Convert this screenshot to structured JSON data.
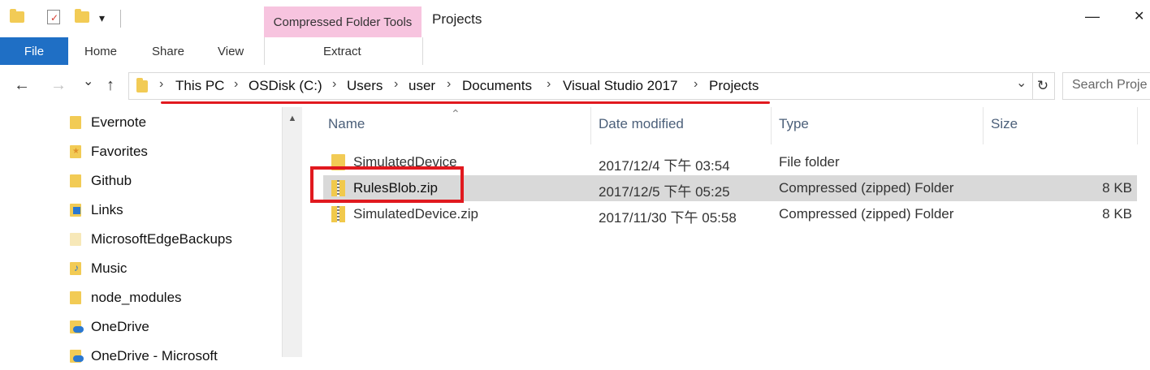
{
  "quick_access": {
    "dropdown_glyph": "▾"
  },
  "title_bar": {
    "contextual_tab": "Compressed Folder Tools",
    "window_title": "Projects",
    "minimize_glyph": "—",
    "close_glyph": "✕"
  },
  "ribbon": {
    "tabs": [
      "File",
      "Home",
      "Share",
      "View",
      "Extract"
    ],
    "file_color": "#1f6fc5",
    "contextual_color": "#f7c4df"
  },
  "address_bar": {
    "crumbs": [
      "This PC",
      "OSDisk (C:)",
      "Users",
      "user",
      "Documents",
      "Visual Studio 2017",
      "Projects"
    ],
    "separator": "›",
    "back_glyph": "←",
    "forward_glyph": "→",
    "recent_glyph": "⌄",
    "up_glyph": "↑",
    "dropdown_glyph": "⌄",
    "refresh_glyph": "↻",
    "search_placeholder": "Search Proje"
  },
  "nav_pane": {
    "items": [
      {
        "label": "Evernote",
        "icon": "folder-icon"
      },
      {
        "label": "Favorites",
        "icon": "favorites-folder-icon"
      },
      {
        "label": "Github",
        "icon": "folder-icon"
      },
      {
        "label": "Links",
        "icon": "links-folder-icon"
      },
      {
        "label": "MicrosoftEdgeBackups",
        "icon": "folder-icon"
      },
      {
        "label": "Music",
        "icon": "music-folder-icon"
      },
      {
        "label": "node_modules",
        "icon": "folder-icon"
      },
      {
        "label": "OneDrive",
        "icon": "onedrive-icon"
      },
      {
        "label": "OneDrive - Microsoft",
        "icon": "onedrive-icon"
      }
    ],
    "scroll_up_glyph": "▲"
  },
  "file_list": {
    "sort_glyph": "⌃",
    "columns": [
      "Name",
      "Date modified",
      "Type",
      "Size"
    ],
    "rows": [
      {
        "name": "SimulatedDevice",
        "date": "2017/12/4 下午 03:54",
        "type": "File folder",
        "size": "",
        "icon": "folder-icon",
        "selected": false
      },
      {
        "name": "RulesBlob.zip",
        "date": "2017/12/5 下午 05:25",
        "type": "Compressed (zipped) Folder",
        "size": "8 KB",
        "icon": "zip-folder-icon",
        "selected": true
      },
      {
        "name": "SimulatedDevice.zip",
        "date": "2017/11/30 下午 05:58",
        "type": "Compressed (zipped) Folder",
        "size": "8 KB",
        "icon": "zip-folder-icon",
        "selected": false
      }
    ]
  },
  "annotation_color": "#e1191f"
}
